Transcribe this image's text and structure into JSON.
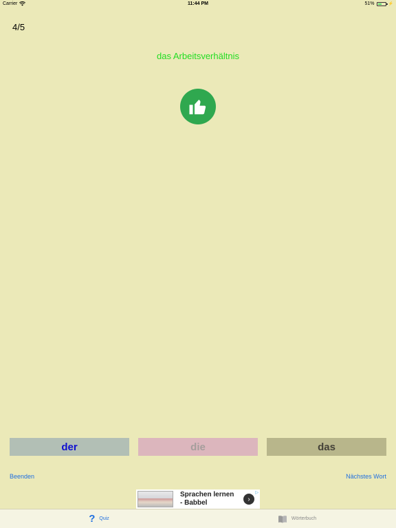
{
  "status_bar": {
    "carrier": "Carrier",
    "time": "11:44 PM",
    "battery_text": "51%",
    "battery_level": 0.51
  },
  "quiz": {
    "progress": "4/5",
    "word": "das Arbeitsverhältnis",
    "feedback_icon": "thumbs-up-icon",
    "feedback_color": "#2fa84f",
    "word_color": "#22dd22"
  },
  "articles": {
    "der": "der",
    "die": "die",
    "das": "das"
  },
  "actions": {
    "end": "Beenden",
    "next": "Nächstes Wort"
  },
  "ad": {
    "line1": "Sprachen lernen",
    "line2": "- Babbel",
    "arrow_icon": "chevron-right-icon",
    "adchoices_icon": "adchoices-icon"
  },
  "tabs": [
    {
      "label": "Quiz",
      "icon": "question-mark-icon",
      "active": true
    },
    {
      "label": "Wörterbuch",
      "icon": "book-icon",
      "active": false
    }
  ]
}
